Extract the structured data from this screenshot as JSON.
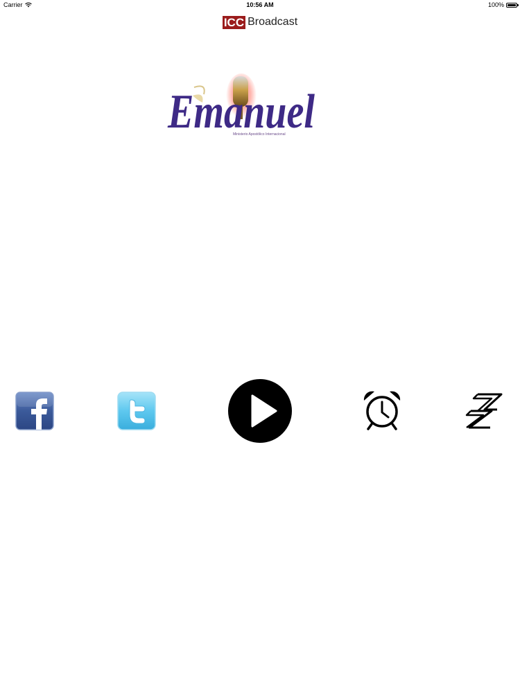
{
  "status_bar": {
    "carrier": "Carrier",
    "time": "10:56 AM",
    "battery_percent_label": "100%",
    "battery_level": 1.0
  },
  "nav": {
    "logo_text": "ICC",
    "title": "Broadcast"
  },
  "brand": {
    "name": "Emanuel",
    "subtitle": "Ministerio Apostólico Internacional"
  },
  "toolbar": {
    "items": [
      {
        "icon": "facebook-icon"
      },
      {
        "icon": "twitter-icon"
      },
      {
        "icon": "play-icon"
      },
      {
        "icon": "alarm-clock-icon"
      },
      {
        "icon": "zz-icon"
      }
    ]
  },
  "colors": {
    "icc_red": "#9b1c1c",
    "facebook_blue": "#3b5a9a",
    "twitter_blue": "#5ec8ef",
    "brand_purple": "#3e2a86",
    "black": "#000000"
  }
}
